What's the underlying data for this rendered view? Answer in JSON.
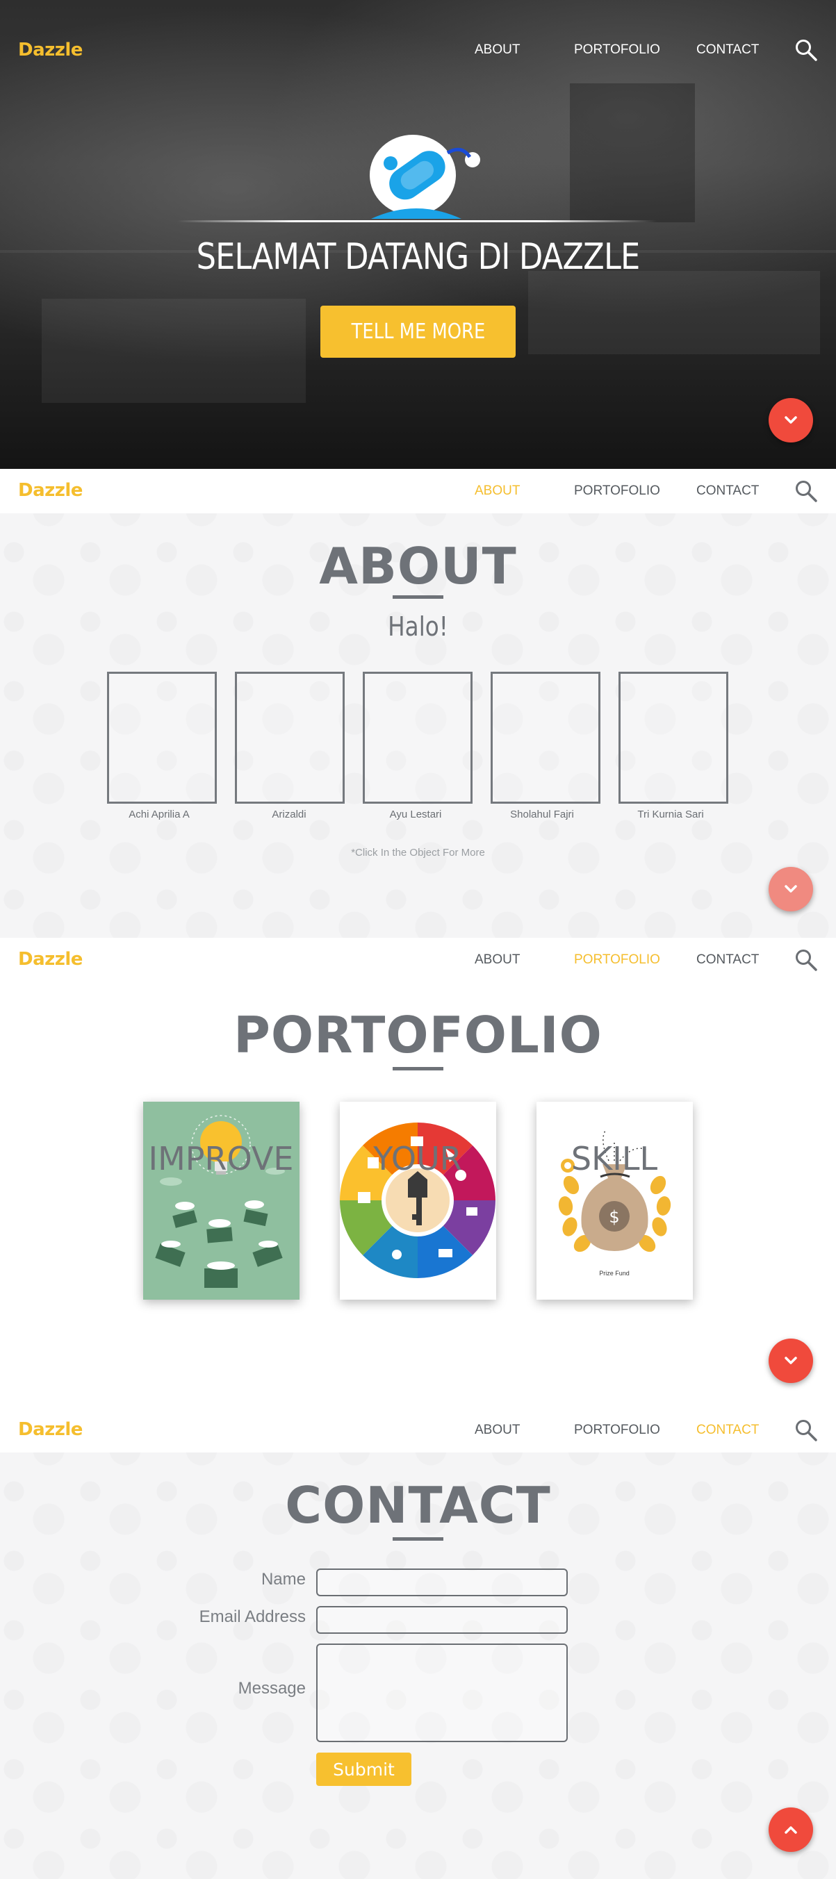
{
  "brand": "Dazzle",
  "nav": {
    "about": "ABOUT",
    "portofolio": "PORTOFOLIO",
    "contact": "CONTACT"
  },
  "hero": {
    "title": "SELAMAT DATANG DI DAZZLE",
    "cta": "TELL ME MORE"
  },
  "about": {
    "title": "ABOUT",
    "subtitle": "Halo!",
    "members": [
      "Achi Aprilia A",
      "Arizaldi",
      "Ayu Lestari",
      "Sholahul Fajri",
      "Tri Kurnia Sari"
    ],
    "hint": "*Click In the Object For More"
  },
  "portfolio": {
    "title": "PORTOFOLIO",
    "cards": [
      "IMPROVE",
      "YOUR",
      "SKILL"
    ],
    "prize_caption": "Prize Fund"
  },
  "contact": {
    "title": "CONTACT",
    "name_label": "Name",
    "email_label": "Email Address",
    "message_label": "Message",
    "submit": "Submit"
  },
  "colors": {
    "brand": "#f5be2e",
    "accent": "#f04a3c",
    "text": "#6e7278"
  }
}
